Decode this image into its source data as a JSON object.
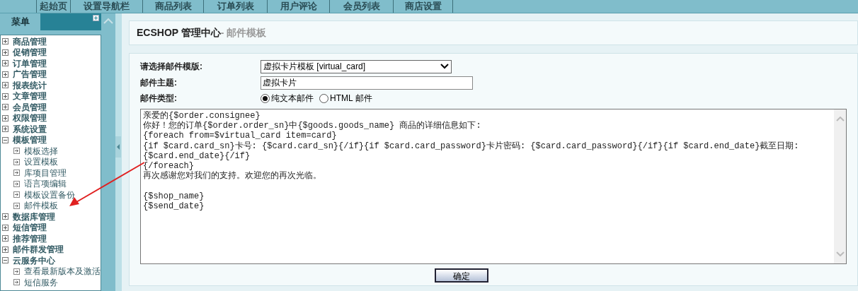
{
  "top_nav": [
    "起始页",
    "设置导航栏",
    "商品列表",
    "订单列表",
    "用户评论",
    "会员列表",
    "商店设置"
  ],
  "sidebar": {
    "title": "菜单",
    "items": [
      {
        "label": "商品管理",
        "expanded": false
      },
      {
        "label": "促销管理",
        "expanded": false
      },
      {
        "label": "订单管理",
        "expanded": false
      },
      {
        "label": "广告管理",
        "expanded": false
      },
      {
        "label": "报表统计",
        "expanded": false
      },
      {
        "label": "文章管理",
        "expanded": false
      },
      {
        "label": "会员管理",
        "expanded": false
      },
      {
        "label": "权限管理",
        "expanded": false
      },
      {
        "label": "系统设置",
        "expanded": false
      },
      {
        "label": "模板管理",
        "expanded": true,
        "children": [
          {
            "label": "模板选择"
          },
          {
            "label": "设置模板"
          },
          {
            "label": "库项目管理"
          },
          {
            "label": "语言项编辑"
          },
          {
            "label": "模板设置备份"
          },
          {
            "label": "邮件模板"
          }
        ]
      },
      {
        "label": "数据库管理",
        "expanded": false
      },
      {
        "label": "短信管理",
        "expanded": false
      },
      {
        "label": "推荐管理",
        "expanded": false
      },
      {
        "label": "邮件群发管理",
        "expanded": false
      },
      {
        "label": "云服务中心",
        "expanded": true,
        "children": [
          {
            "label": "查看最新版本及激活"
          },
          {
            "label": "短信服务"
          }
        ]
      }
    ]
  },
  "page_title": {
    "app": "ECSHOP 管理中心",
    "section": "- 邮件模板"
  },
  "form": {
    "template_label": "请选择邮件模版:",
    "template_value": "虚拟卡片模板 [virtual_card]",
    "subject_label": "邮件主题:",
    "subject_value": "虚拟卡片",
    "type_label": "邮件类型:",
    "type_options": [
      {
        "label": "纯文本邮件",
        "selected": true
      },
      {
        "label": "HTML 邮件",
        "selected": false
      }
    ],
    "body_lines": [
      "亲爱的{$order.consignee}",
      "你好！您的订单{$order.order_sn}中{$goods.goods_name} 商品的详细信息如下:",
      "{foreach from=$virtual_card item=card}",
      "{if $card.card_sn}卡号: {$card.card_sn}{/if}{if $card.card_password}卡片密码: {$card.card_password}{/if}{if $card.end_date}截至日期:",
      "{$card.end_date}{/if}",
      "{/foreach}",
      "再次感谢您对我们的支持。欢迎您的再次光临。"
    ],
    "signature_lines": [
      "{$shop_name}",
      "{$send_date}"
    ],
    "submit": "确定"
  }
}
